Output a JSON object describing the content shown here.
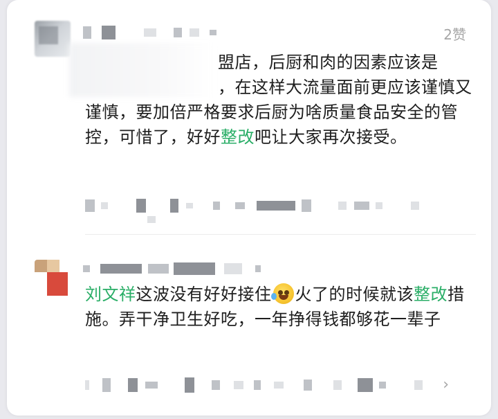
{
  "comments": [
    {
      "like_count": "2赞",
      "text_lines": [
        "盟店，后厨和肉的因素应该是",
        "，在这样大流量面前更应该谨慎又谨慎，要加倍严格要求后厨为啥质量食品安全的管控，可惜了，好好",
        "整改",
        "吧让大家再次接受。"
      ]
    },
    {
      "mention": "刘文祥",
      "text_part1": "这波没有好好接住",
      "emoji": "tears-of-joy-emoji",
      "text_part2": "火了的时候就该",
      "highlight": "整改",
      "text_part3": "措施。弄干净卫生好吃，一年挣得钱都够花一辈子",
      "chevron": "›"
    }
  ]
}
